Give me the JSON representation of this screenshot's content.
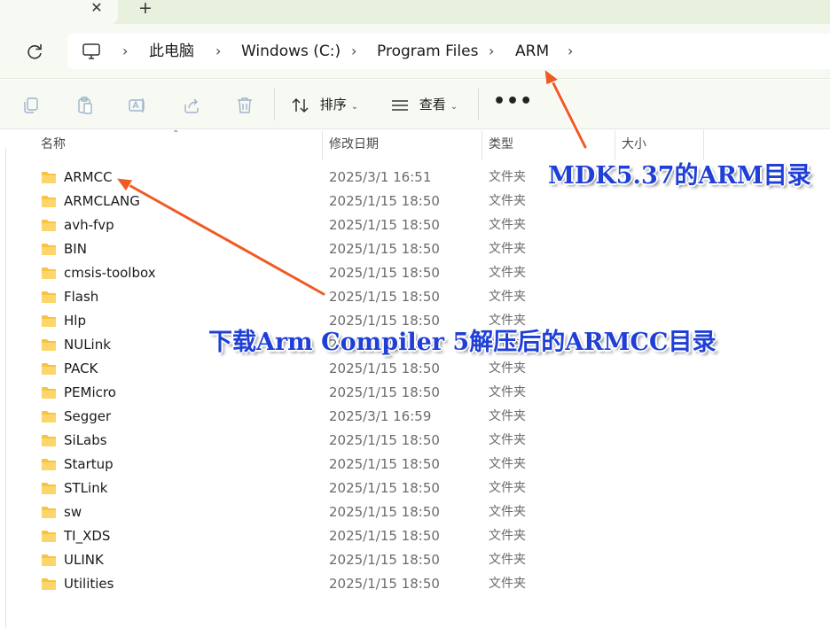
{
  "tabs": {
    "close_icon": "close-icon",
    "new_tab_icon": "plus-icon"
  },
  "breadcrumb": {
    "items": [
      "此电脑",
      "Windows (C:)",
      "Program Files",
      "ARM"
    ],
    "separator": "›"
  },
  "toolbar": {
    "sort_label": "排序",
    "view_label": "查看",
    "more_label": "•••"
  },
  "columns": {
    "name": "名称",
    "modified": "修改日期",
    "type": "类型",
    "size": "大小"
  },
  "files": [
    {
      "name": "ARMCC",
      "modified": "2025/3/1 16:51",
      "type": "文件夹"
    },
    {
      "name": "ARMCLANG",
      "modified": "2025/1/15 18:50",
      "type": "文件夹"
    },
    {
      "name": "avh-fvp",
      "modified": "2025/1/15 18:50",
      "type": "文件夹"
    },
    {
      "name": "BIN",
      "modified": "2025/1/15 18:50",
      "type": "文件夹"
    },
    {
      "name": "cmsis-toolbox",
      "modified": "2025/1/15 18:50",
      "type": "文件夹"
    },
    {
      "name": "Flash",
      "modified": "2025/1/15 18:50",
      "type": "文件夹"
    },
    {
      "name": "Hlp",
      "modified": "2025/1/15 18:50",
      "type": "文件夹"
    },
    {
      "name": "NULink",
      "modified": "2025/1/15 18:50",
      "type": "文件夹"
    },
    {
      "name": "PACK",
      "modified": "2025/1/15 18:50",
      "type": "文件夹"
    },
    {
      "name": "PEMicro",
      "modified": "2025/1/15 18:50",
      "type": "文件夹"
    },
    {
      "name": "Segger",
      "modified": "2025/3/1 16:59",
      "type": "文件夹"
    },
    {
      "name": "SiLabs",
      "modified": "2025/1/15 18:50",
      "type": "文件夹"
    },
    {
      "name": "Startup",
      "modified": "2025/1/15 18:50",
      "type": "文件夹"
    },
    {
      "name": "STLink",
      "modified": "2025/1/15 18:50",
      "type": "文件夹"
    },
    {
      "name": "sw",
      "modified": "2025/1/15 18:50",
      "type": "文件夹"
    },
    {
      "name": "TI_XDS",
      "modified": "2025/1/15 18:50",
      "type": "文件夹"
    },
    {
      "name": "ULINK",
      "modified": "2025/1/15 18:50",
      "type": "文件夹"
    },
    {
      "name": "Utilities",
      "modified": "2025/1/15 18:50",
      "type": "文件夹"
    }
  ],
  "annotations": {
    "arm_dir": "MDK5.37的ARM目录",
    "armcc_dir": "下载Arm Compiler 5解压后的ARMCC目录"
  },
  "colors": {
    "annotation_text": "#1f3fd6",
    "arrow": "#f05a23",
    "folder": "#f6c343",
    "chrome_background": "#f7faf3"
  }
}
